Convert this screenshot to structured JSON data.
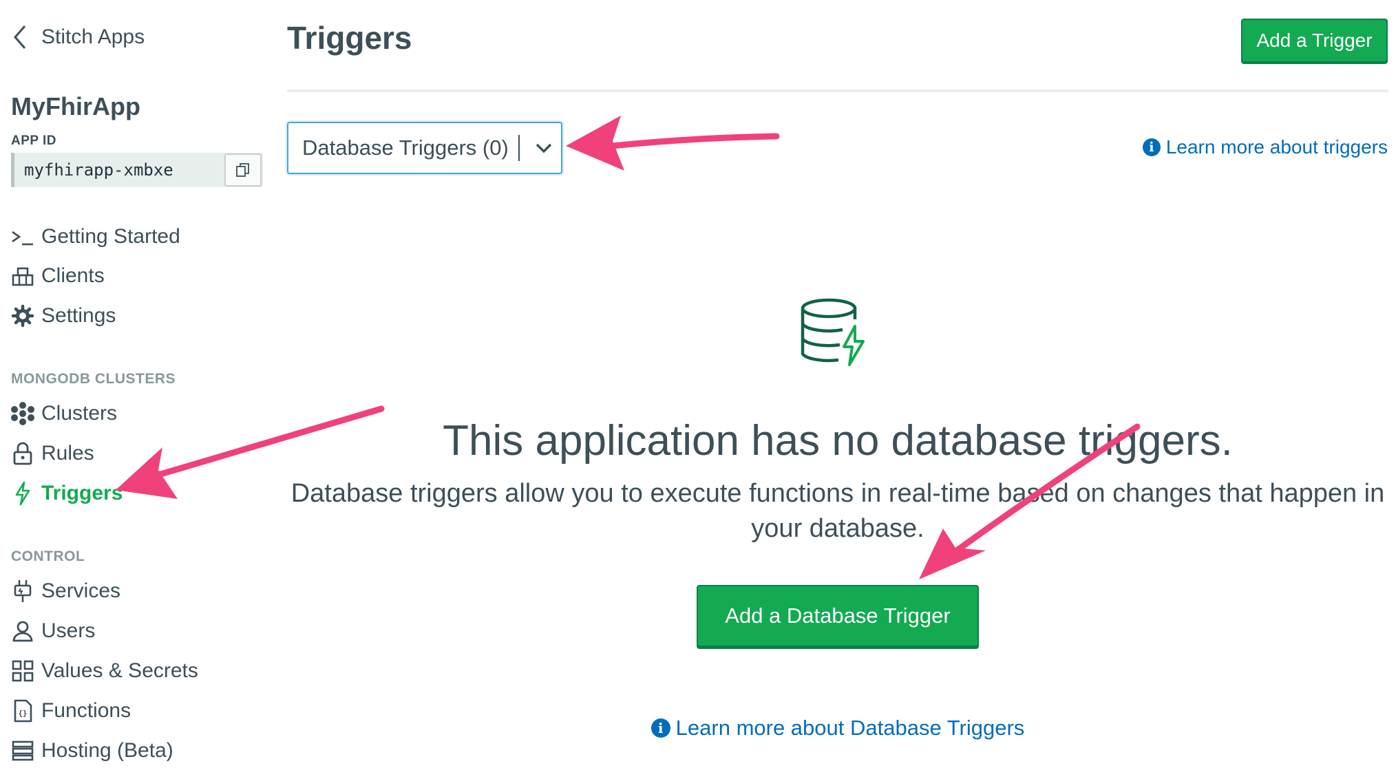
{
  "sidebar": {
    "back_label": "Stitch Apps",
    "app_name": "MyFhirApp",
    "app_id_label": "APP ID",
    "app_id": "myfhirapp-xmbxe",
    "top_items": [
      {
        "label": "Getting Started",
        "icon": "terminal-icon"
      },
      {
        "label": "Clients",
        "icon": "clients-icon"
      },
      {
        "label": "Settings",
        "icon": "gear-icon"
      }
    ],
    "sections": [
      {
        "header": "MONGODB CLUSTERS",
        "items": [
          {
            "label": "Clusters",
            "icon": "clusters-icon"
          },
          {
            "label": "Rules",
            "icon": "lock-icon"
          },
          {
            "label": "Triggers",
            "icon": "bolt-icon",
            "active": true
          }
        ]
      },
      {
        "header": "CONTROL",
        "items": [
          {
            "label": "Services",
            "icon": "services-plug-icon"
          },
          {
            "label": "Users",
            "icon": "user-icon"
          },
          {
            "label": "Values & Secrets",
            "icon": "grid-icon"
          },
          {
            "label": "Functions",
            "icon": "functions-icon"
          },
          {
            "label": "Hosting (Beta)",
            "icon": "server-icon"
          }
        ]
      }
    ]
  },
  "header": {
    "title": "Triggers",
    "add_button": "Add a Trigger"
  },
  "trigger_type": {
    "selected": "Database Triggers (0)"
  },
  "learn_more_top": "Learn more about triggers",
  "empty_state": {
    "icon": "database-bolt-icon",
    "title": "This application has no database triggers.",
    "description": "Database triggers allow you to execute functions in real-time based on changes that happen in your database.",
    "button": "Add a Database Trigger",
    "learn_more": "Learn more about Database Triggers"
  },
  "colors": {
    "accent_green": "#13aa52",
    "link_blue": "#006cbc",
    "annotation_arrow": "#f0417a",
    "text": "#3d4f58"
  }
}
